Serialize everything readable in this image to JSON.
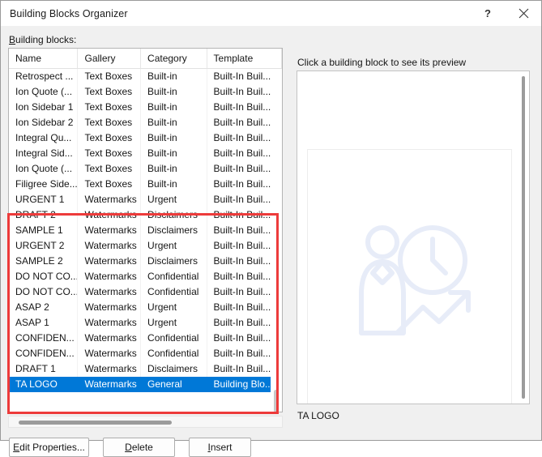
{
  "window": {
    "title": "Building Blocks Organizer",
    "help_icon": "question-mark-icon",
    "close_icon": "close-icon"
  },
  "left_panel": {
    "label": "Building blocks:",
    "label_accel": "B",
    "columns": [
      "Name",
      "Gallery",
      "Category",
      "Template"
    ],
    "rows": [
      {
        "name": "Retrospect ...",
        "gallery": "Text Boxes",
        "category": "Built-in",
        "template": "Built-In Buil...",
        "selected": false,
        "highlighted": false
      },
      {
        "name": "Ion Quote (...",
        "gallery": "Text Boxes",
        "category": "Built-in",
        "template": "Built-In Buil...",
        "selected": false,
        "highlighted": false
      },
      {
        "name": "Ion Sidebar 1",
        "gallery": "Text Boxes",
        "category": "Built-in",
        "template": "Built-In Buil...",
        "selected": false,
        "highlighted": false
      },
      {
        "name": "Ion Sidebar 2",
        "gallery": "Text Boxes",
        "category": "Built-in",
        "template": "Built-In Buil...",
        "selected": false,
        "highlighted": false
      },
      {
        "name": "Integral Qu...",
        "gallery": "Text Boxes",
        "category": "Built-in",
        "template": "Built-In Buil...",
        "selected": false,
        "highlighted": false
      },
      {
        "name": "Integral Sid...",
        "gallery": "Text Boxes",
        "category": "Built-in",
        "template": "Built-In Buil...",
        "selected": false,
        "highlighted": false
      },
      {
        "name": "Ion Quote (...",
        "gallery": "Text Boxes",
        "category": "Built-in",
        "template": "Built-In Buil...",
        "selected": false,
        "highlighted": false
      },
      {
        "name": "Filigree Side...",
        "gallery": "Text Boxes",
        "category": "Built-in",
        "template": "Built-In Buil...",
        "selected": false,
        "highlighted": false
      },
      {
        "name": "URGENT 1",
        "gallery": "Watermarks",
        "category": "Urgent",
        "template": "Built-In Buil...",
        "selected": false,
        "highlighted": true
      },
      {
        "name": "DRAFT 2",
        "gallery": "Watermarks",
        "category": "Disclaimers",
        "template": "Built-In Buil...",
        "selected": false,
        "highlighted": true
      },
      {
        "name": "SAMPLE 1",
        "gallery": "Watermarks",
        "category": "Disclaimers",
        "template": "Built-In Buil...",
        "selected": false,
        "highlighted": true
      },
      {
        "name": "URGENT 2",
        "gallery": "Watermarks",
        "category": "Urgent",
        "template": "Built-In Buil...",
        "selected": false,
        "highlighted": true
      },
      {
        "name": "SAMPLE 2",
        "gallery": "Watermarks",
        "category": "Disclaimers",
        "template": "Built-In Buil...",
        "selected": false,
        "highlighted": true
      },
      {
        "name": "DO NOT CO...",
        "gallery": "Watermarks",
        "category": "Confidential",
        "template": "Built-In Buil...",
        "selected": false,
        "highlighted": true
      },
      {
        "name": "DO NOT CO...",
        "gallery": "Watermarks",
        "category": "Confidential",
        "template": "Built-In Buil...",
        "selected": false,
        "highlighted": true
      },
      {
        "name": "ASAP 2",
        "gallery": "Watermarks",
        "category": "Urgent",
        "template": "Built-In Buil...",
        "selected": false,
        "highlighted": true
      },
      {
        "name": "ASAP 1",
        "gallery": "Watermarks",
        "category": "Urgent",
        "template": "Built-In Buil...",
        "selected": false,
        "highlighted": true
      },
      {
        "name": "CONFIDEN...",
        "gallery": "Watermarks",
        "category": "Confidential",
        "template": "Built-In Buil...",
        "selected": false,
        "highlighted": true
      },
      {
        "name": "CONFIDEN...",
        "gallery": "Watermarks",
        "category": "Confidential",
        "template": "Built-In Buil...",
        "selected": false,
        "highlighted": true
      },
      {
        "name": "DRAFT 1",
        "gallery": "Watermarks",
        "category": "Disclaimers",
        "template": "Built-In Buil...",
        "selected": false,
        "highlighted": true
      },
      {
        "name": "TA LOGO",
        "gallery": "Watermarks",
        "category": "General",
        "template": "Building Blo...",
        "selected": true,
        "highlighted": true
      }
    ],
    "selection_color": "#0078d7",
    "annotation_color": "#ed3b3b"
  },
  "buttons": [
    {
      "label": "Edit Properties...",
      "accel": "E",
      "name": "edit-properties-button"
    },
    {
      "label": "Delete",
      "accel": "D",
      "name": "delete-button"
    },
    {
      "label": "Insert",
      "accel": "I",
      "name": "insert-button"
    }
  ],
  "right_panel": {
    "label": "Click a building block to see its preview",
    "caption": "TA LOGO",
    "logo_icon": "person-clock-growth-arrow-logo",
    "logo_color": "#e8edf8"
  }
}
